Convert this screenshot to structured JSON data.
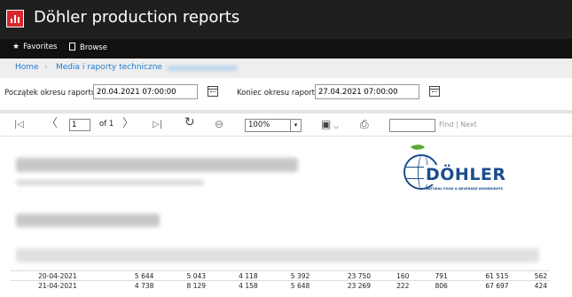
{
  "app": {
    "title": "Döhler production reports"
  },
  "menu": {
    "favorites": "Favorites",
    "browse": "Browse"
  },
  "breadcrumb": {
    "home": "Home",
    "separator": "›",
    "section": "Media i raporty techniczne"
  },
  "params": {
    "start_label": "Początek okresu raportu",
    "start_value": "20.04.2021 07:00:00",
    "end_label": "Koniec okresu raportu",
    "end_value": "27.04.2021 07:00:00"
  },
  "toolbar": {
    "first": "|◁",
    "prev": "〈",
    "page": "1",
    "of": "of 1",
    "next": "〉",
    "last": "▷|",
    "zoom": "100%",
    "zoom_arrow": "▾",
    "save_arrow": "⌵",
    "find": "Find",
    "next_link": "| Next"
  },
  "logo": {
    "word": "DÖHLER",
    "tagline": "NATURAL FOOD & BEVERAGE INGREDIENTS"
  },
  "colors": {
    "titlebar": "#1f1f1f",
    "menubar": "#111111",
    "link": "#1e7bd2",
    "logo_blue": "#1a4e8c",
    "logo_green": "#5aa832",
    "app_icon": "#d9262c"
  },
  "icons": [
    "report-app-icon",
    "star-icon",
    "document-icon",
    "calendar-icon",
    "first-page-icon",
    "prev-page-icon",
    "next-page-icon",
    "last-page-icon",
    "refresh-icon",
    "back-icon",
    "save-icon",
    "print-icon"
  ],
  "table": {
    "rows": [
      [
        "20-04-2021",
        "5 644",
        "5 043",
        "4 118",
        "5 392",
        "23 750",
        "160",
        "791",
        "61 515",
        "562"
      ],
      [
        "21-04-2021",
        "4 738",
        "8 129",
        "4 158",
        "5 648",
        "23 269",
        "222",
        "806",
        "67 697",
        "424"
      ]
    ]
  }
}
